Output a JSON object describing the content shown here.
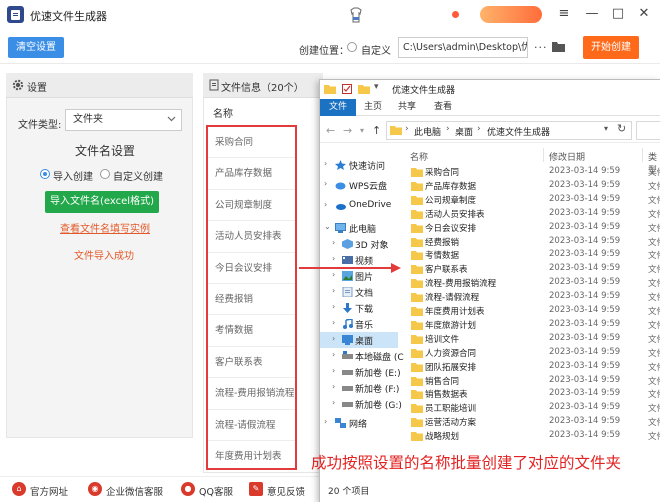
{
  "app": {
    "title": "优速文件生成器"
  },
  "toolbar": {
    "clear_label": "清空设置",
    "location_label": "创建位置：",
    "location_option": "自定义",
    "path_value": "C:\\Users\\admin\\Desktop\\优速",
    "more_label": "···",
    "start_label": "开始创建"
  },
  "settings": {
    "title": "设置",
    "filetype_label": "文件类型:",
    "filetype_value": "文件夹",
    "naming_heading": "文件名设置",
    "option_import": "导入创建",
    "option_custom": "自定义创建",
    "import_button": "导入文件名(excel格式)",
    "example_link": "查看文件名填写实例",
    "import_status": "文件导入成功"
  },
  "file_info": {
    "title": "文件信息（20个）",
    "name_header": "名称",
    "names": [
      "采购合同",
      "产品库存数据",
      "公司规章制度",
      "活动人员安排表",
      "今日会议安排",
      "经费报销",
      "考情数据",
      "客户联系表",
      "流程-费用报销流程",
      "流程-请假流程",
      "年度费用计划表"
    ]
  },
  "footer": {
    "items": [
      {
        "label": "官方网址",
        "icon": "home-icon"
      },
      {
        "label": "企业微信客服",
        "icon": "wechat-icon"
      },
      {
        "label": "QQ客服",
        "icon": "qq-icon"
      },
      {
        "label": "意见反馈",
        "icon": "feedback-icon"
      }
    ]
  },
  "explorer": {
    "title": "优速文件生成器",
    "tabs": [
      "文件",
      "主页",
      "共享",
      "查看"
    ],
    "breadcrumb": [
      "此电脑",
      "桌面",
      "优速文件生成器"
    ],
    "nav_items": [
      {
        "label": "快速访问",
        "icon": "star-icon"
      },
      {
        "label": "WPS云盘",
        "icon": "cloud-icon"
      },
      {
        "label": "OneDrive",
        "icon": "onedrive-icon"
      },
      {
        "label": "此电脑",
        "icon": "computer-icon"
      },
      {
        "label": "3D 对象",
        "icon": "cube-icon"
      },
      {
        "label": "视频",
        "icon": "video-icon"
      },
      {
        "label": "图片",
        "icon": "picture-icon"
      },
      {
        "label": "文档",
        "icon": "document-icon"
      },
      {
        "label": "下载",
        "icon": "download-icon"
      },
      {
        "label": "音乐",
        "icon": "music-icon"
      },
      {
        "label": "桌面",
        "icon": "desktop-icon"
      },
      {
        "label": "本地磁盘 (C",
        "icon": "drive-icon"
      },
      {
        "label": "新加卷 (E:)",
        "icon": "drive-icon"
      },
      {
        "label": "新加卷 (F:)",
        "icon": "drive-icon"
      },
      {
        "label": "新加卷 (G:)",
        "icon": "drive-icon"
      },
      {
        "label": "网络",
        "icon": "network-icon"
      }
    ],
    "columns": {
      "name": "名称",
      "date": "修改日期",
      "type": "类型"
    },
    "files": [
      {
        "name": "采购合同",
        "date": "2023-03-14 9:59",
        "type": "文件"
      },
      {
        "name": "产品库存数据",
        "date": "2023-03-14 9:59",
        "type": "文件"
      },
      {
        "name": "公司规章制度",
        "date": "2023-03-14 9:59",
        "type": "文件"
      },
      {
        "name": "活动人员安排表",
        "date": "2023-03-14 9:59",
        "type": "文件"
      },
      {
        "name": "今日会议安排",
        "date": "2023-03-14 9:59",
        "type": "文件"
      },
      {
        "name": "经费报销",
        "date": "2023-03-14 9:59",
        "type": "文件"
      },
      {
        "name": "考情数据",
        "date": "2023-03-14 9:59",
        "type": "文件"
      },
      {
        "name": "客户联系表",
        "date": "2023-03-14 9:59",
        "type": "文件"
      },
      {
        "name": "流程-费用报销流程",
        "date": "2023-03-14 9:59",
        "type": "文件"
      },
      {
        "name": "流程-请假流程",
        "date": "2023-03-14 9:59",
        "type": "文件"
      },
      {
        "name": "年度费用计划表",
        "date": "2023-03-14 9:59",
        "type": "文件"
      },
      {
        "name": "年度旅游计划",
        "date": "2023-03-14 9:59",
        "type": "文件"
      },
      {
        "name": "培训文件",
        "date": "2023-03-14 9:59",
        "type": "文件"
      },
      {
        "name": "人力资源合同",
        "date": "2023-03-14 9:59",
        "type": "文件"
      },
      {
        "name": "团队拓展安排",
        "date": "2023-03-14 9:59",
        "type": "文件"
      },
      {
        "name": "销售合同",
        "date": "2023-03-14 9:59",
        "type": "文件"
      },
      {
        "name": "销售数据表",
        "date": "2023-03-14 9:59",
        "type": "文件"
      },
      {
        "name": "员工职能培训",
        "date": "2023-03-14 9:59",
        "type": "文件"
      },
      {
        "name": "运营活动方案",
        "date": "2023-03-14 9:59",
        "type": "文件"
      },
      {
        "name": "战略规划",
        "date": "2023-03-14 9:59",
        "type": "文件"
      }
    ],
    "item_count": "20 个项目"
  },
  "annotation": {
    "caption": "成功按照设置的名称批量创建了对应的文件夹"
  },
  "colors": {
    "primary_blue": "#3a8ee6",
    "start_orange": "#ff6a1a",
    "import_green": "#22a84a",
    "highlight_red": "#e23b3b",
    "folder_yellow": "#f5c84a"
  }
}
